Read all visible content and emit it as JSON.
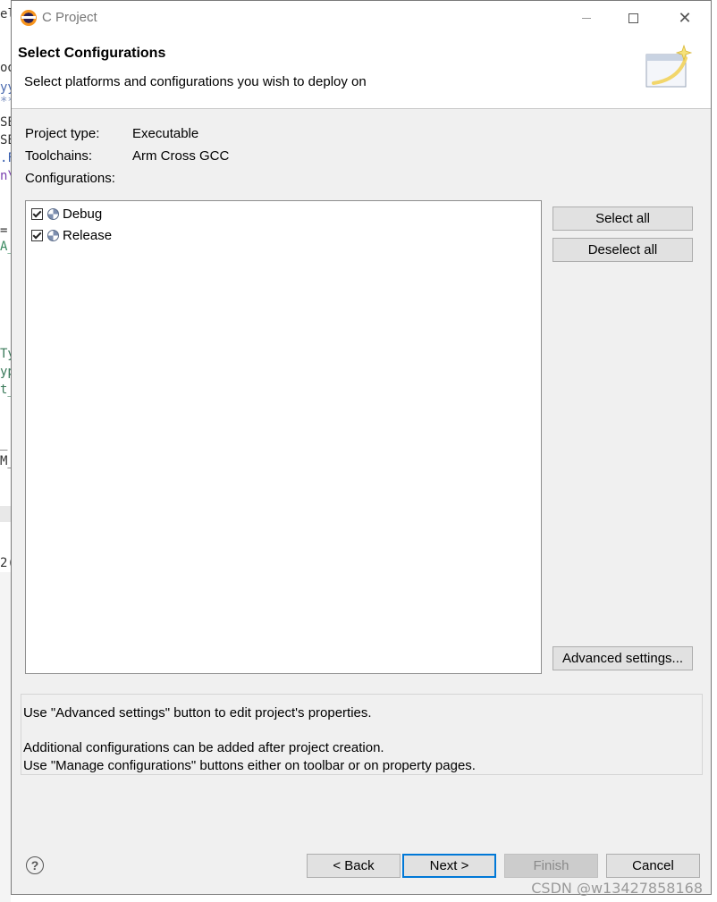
{
  "window": {
    "title": "C Project",
    "controls": {
      "minimize_icon": "minimize-icon",
      "maximize_icon": "maximize-icon",
      "close_icon": "close-icon",
      "close_glyph": "✕"
    }
  },
  "header": {
    "title": "Select Configurations",
    "description": "Select platforms and configurations you wish to deploy on"
  },
  "project_info": {
    "project_type_label": "Project type:",
    "project_type_value": "Executable",
    "toolchains_label": "Toolchains:",
    "toolchains_value": "Arm Cross GCC",
    "configurations_label": "Configurations:"
  },
  "configurations": [
    {
      "label": "Debug",
      "checked": true
    },
    {
      "label": "Release",
      "checked": true
    }
  ],
  "side_buttons": {
    "select_all": "Select all",
    "deselect_all": "Deselect all",
    "advanced_settings": "Advanced settings..."
  },
  "info_box": {
    "line1": "Use \"Advanced settings\" button to edit project's properties.",
    "line2": "Additional configurations can be added after project creation.",
    "line3": "Use \"Manage configurations\" buttons either on toolbar or on property pages."
  },
  "footer": {
    "help_glyph": "?",
    "back": "< Back",
    "next": "Next >",
    "finish": "Finish",
    "cancel": "Cancel"
  },
  "background_editor_fragments": [
    "el",
    "oo",
    "yy",
    "**",
    "SE",
    "SE",
    ".F",
    "n\\",
    "=",
    "A_",
    "Ty",
    "yp",
    "t_",
    "_",
    "M_",
    "2("
  ],
  "watermark": "CSDN @w13427858168"
}
